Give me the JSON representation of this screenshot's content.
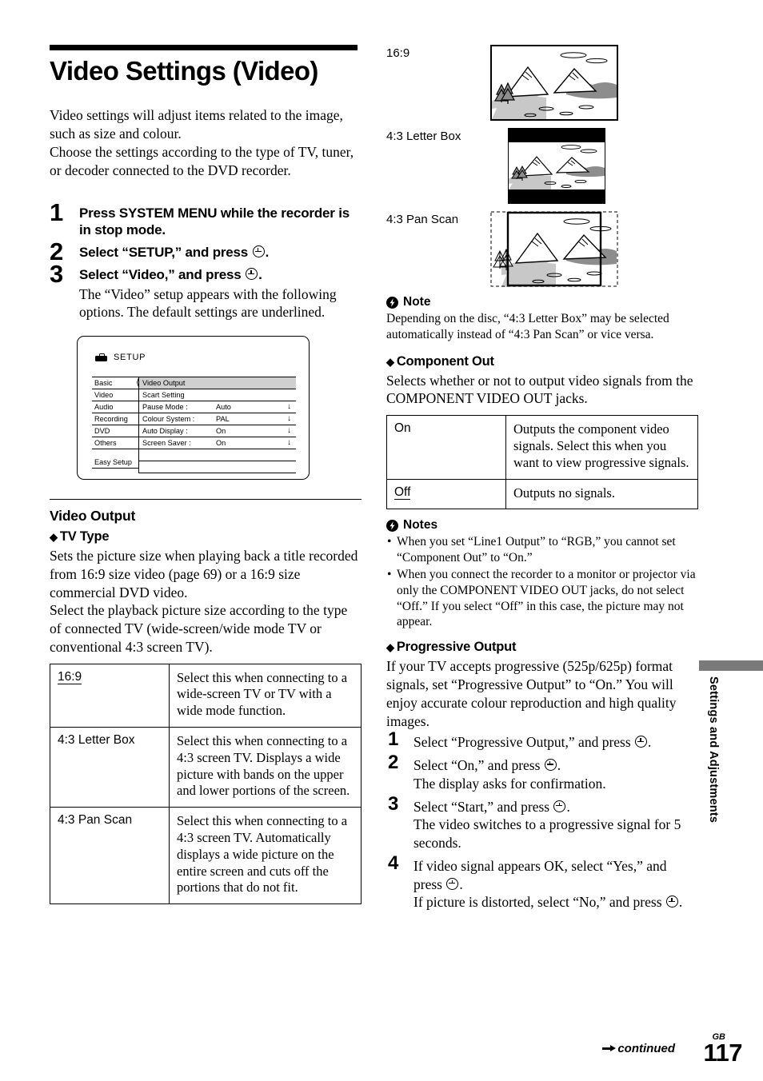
{
  "page": {
    "title": "Video Settings (Video)",
    "intro": "Video settings will adjust items related to the image, such as size and colour.\nChoose the settings according to the type of TV, tuner, or decoder connected to the DVD recorder.",
    "footer_continued": "continued",
    "footer_region": "GB",
    "footer_page": "117",
    "side_tab": "Settings and Adjustments"
  },
  "steps": [
    {
      "num": "1",
      "head": "Press SYSTEM MENU while the recorder is in stop mode.",
      "body": ""
    },
    {
      "num": "2",
      "head": "Select “SETUP,” and press",
      "head_suffix": ".",
      "body": ""
    },
    {
      "num": "3",
      "head": "Select “Video,” and press",
      "head_suffix": ".",
      "body": "The “Video” setup appears with the following options. The default settings are underlined."
    }
  ],
  "osd": {
    "title": "SETUP",
    "icon": "toolbox-icon",
    "categories": [
      "Basic",
      "Video",
      "Audio",
      "Recording",
      "DVD",
      "Others"
    ],
    "easy_setup": "Easy Setup",
    "rows": [
      {
        "key": "Video Output",
        "value": "",
        "arrow": "",
        "selected": true
      },
      {
        "key": "Scart Setting",
        "value": "",
        "arrow": "",
        "selected": false
      },
      {
        "key": "Pause Mode :",
        "value": "Auto",
        "arrow": "↓",
        "selected": false
      },
      {
        "key": "Colour System :",
        "value": "PAL",
        "arrow": "↓",
        "selected": false
      },
      {
        "key": "Auto Display :",
        "value": "On",
        "arrow": "↓",
        "selected": false
      },
      {
        "key": "Screen Saver :",
        "value": "On",
        "arrow": "↓",
        "selected": false
      },
      {
        "key": "",
        "value": "",
        "arrow": "",
        "selected": false
      },
      {
        "key": "",
        "value": "",
        "arrow": "",
        "selected": false
      }
    ]
  },
  "video_output": {
    "heading": "Video Output",
    "tv_type": {
      "heading": "TV Type",
      "body": "Sets the picture size when playing back a title recorded from 16:9 size video (page 69) or a 16:9 size commercial DVD video.\nSelect the playback picture size according to the type of connected TV (wide-screen/wide mode TV or conventional 4:3 screen TV).",
      "options": [
        {
          "key": "16:9",
          "underlined": true,
          "desc": "Select this when connecting to a wide-screen TV or TV with a wide mode function."
        },
        {
          "key": "4:3 Letter Box",
          "underlined": false,
          "desc": "Select this when connecting to a 4:3 screen TV. Displays a wide picture with bands on the upper and lower portions of the screen."
        },
        {
          "key": "4:3 Pan Scan",
          "underlined": false,
          "desc": "Select this when connecting to a 4:3 screen TV. Automatically displays a wide picture on the entire screen and cuts off the portions that do not fit."
        }
      ]
    }
  },
  "illustrations": [
    {
      "label": "16:9",
      "mode": "wide"
    },
    {
      "label": "4:3 Letter Box",
      "mode": "letterbox"
    },
    {
      "label": "4:3 Pan Scan",
      "mode": "panscan"
    }
  ],
  "note_tv_type": {
    "heading": "Note",
    "icon": "note-bolt-icon",
    "body": "Depending on the disc, “4:3 Letter Box” may be selected automatically instead of “4:3 Pan Scan” or vice versa."
  },
  "component_out": {
    "heading": "Component Out",
    "body": "Selects whether or not to output video signals from the COMPONENT VIDEO OUT jacks.",
    "options": [
      {
        "key": "On",
        "underlined": false,
        "desc": "Outputs the component video signals. Select this when you want to view progressive signals."
      },
      {
        "key": "Off",
        "underlined": true,
        "desc": "Outputs no signals."
      }
    ],
    "notes_heading": "Notes",
    "notes": [
      "When you set “Line1 Output” to “RGB,” you cannot set “Component Out” to “On.”",
      "When you connect the recorder to a monitor or projector via only the COMPONENT VIDEO OUT jacks, do not select “Off.” If you select “Off” in this case, the picture may not appear."
    ]
  },
  "progressive_output": {
    "heading": "Progressive Output",
    "body": "If your TV accepts progressive (525p/625p) format signals, set “Progressive Output” to “On.” You will enjoy accurate colour reproduction and high quality images.",
    "steps": [
      {
        "num": "1",
        "line1_a": "Select “Progressive Output,” and press",
        "line1_b": ".",
        "extra": ""
      },
      {
        "num": "2",
        "line1_a": "Select “On,” and press",
        "line1_b": ".",
        "extra": "The display asks for confirmation."
      },
      {
        "num": "3",
        "line1_a": "Select “Start,” and press",
        "line1_b": ".",
        "extra": "The video switches to a progressive signal for 5 seconds."
      },
      {
        "num": "4",
        "line1_a": "If video signal appears OK, select “Yes,” and press",
        "line1_b": ".",
        "extra": "If picture is distorted, select “No,” and press"
      }
    ]
  },
  "colors": {
    "ink": "#000000",
    "menu_highlight": "#cfcfcf",
    "side_tab_bar": "#7a7a7a",
    "scene_light_gray": "#c8c8c8",
    "scene_dark_gray": "#8d8d8d"
  }
}
